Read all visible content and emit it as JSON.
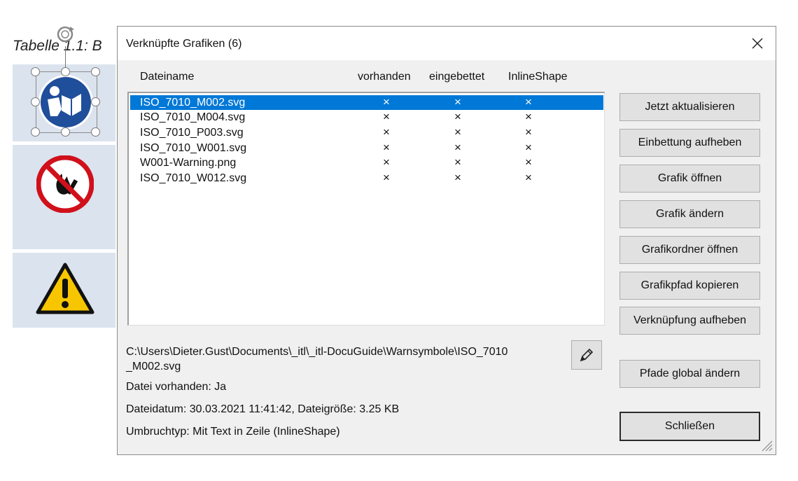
{
  "document": {
    "caption": "Tabelle 1.1: B"
  },
  "dialog": {
    "title": "Verknüpfte Grafiken (6)",
    "columns": [
      "Dateiname",
      "vorhanden",
      "eingebettet",
      "InlineShape"
    ],
    "mark_symbol": "×",
    "files": [
      {
        "name": "ISO_7010_M002.svg",
        "vorhanden": "×",
        "eingebettet": "×",
        "inline": "×",
        "selected": true
      },
      {
        "name": "ISO_7010_M004.svg",
        "vorhanden": "×",
        "eingebettet": "×",
        "inline": "×"
      },
      {
        "name": "ISO_7010_P003.svg",
        "vorhanden": "×",
        "eingebettet": "×",
        "inline": "×"
      },
      {
        "name": "ISO_7010_W001.svg",
        "vorhanden": "×",
        "eingebettet": "×",
        "inline": "×"
      },
      {
        "name": "W001-Warning.png",
        "vorhanden": "×",
        "eingebettet": "×",
        "inline": "×"
      },
      {
        "name": "ISO_7010_W012.svg",
        "vorhanden": "×",
        "eingebettet": "×",
        "inline": "×"
      }
    ],
    "path_line1": "C:\\Users\\Dieter.Gust\\Documents\\_itl\\_itl-DocuGuide\\Warnsymbole\\ISO_7010",
    "path_line2": "_M002.svg",
    "file_exists": "Datei vorhanden: Ja",
    "file_date_size": "Dateidatum: 30.03.2021 11:41:42,  Dateigröße: 3.25 KB",
    "wrap_type": "Umbruchtyp: Mit Text in Zeile (InlineShape)",
    "buttons": {
      "update_now": "Jetzt aktualisieren",
      "remove_embed": "Einbettung aufheben",
      "open_graphic": "Grafik öffnen",
      "change_graphic": "Grafik ändern",
      "open_folder": "Grafikordner öffnen",
      "copy_path": "Grafikpfad kopieren",
      "unlink": "Verknüpfung aufheben",
      "change_paths_global": "Pfade global ändern",
      "close": "Schließen"
    },
    "icons": [
      "close-icon",
      "pencil-icon",
      "resize-grip-icon"
    ]
  },
  "colors": {
    "selection": "#0078d7",
    "dialog_bg": "#f0f0f0",
    "table_cell": "#dbe3ee",
    "mandatory_blue": "#1f4e9a",
    "prohibition_red": "#d0101a",
    "warning_yellow": "#f7c600"
  }
}
